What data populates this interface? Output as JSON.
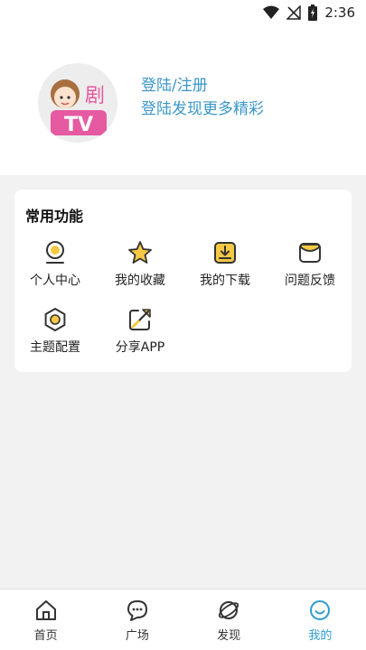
{
  "status_bar": {
    "time": "2:36",
    "icons": [
      "wifi-icon",
      "no-signal-icon",
      "battery-charging-icon"
    ]
  },
  "profile": {
    "avatar_text": "剧",
    "avatar_logo": "TV",
    "login_label": "登陆/注册",
    "login_subtitle": "登陆发现更多精彩"
  },
  "functions": {
    "title": "常用功能",
    "items": [
      {
        "label": "个人中心",
        "icon": "user-center-icon"
      },
      {
        "label": "我的收藏",
        "icon": "star-icon"
      },
      {
        "label": "我的下载",
        "icon": "download-icon"
      },
      {
        "label": "问题反馈",
        "icon": "feedback-mail-icon"
      },
      {
        "label": "主题配置",
        "icon": "theme-settings-icon"
      },
      {
        "label": "分享APP",
        "icon": "share-icon"
      }
    ]
  },
  "bottom_nav": {
    "items": [
      {
        "label": "首页",
        "icon": "home-icon"
      },
      {
        "label": "广场",
        "icon": "chat-bubble-icon"
      },
      {
        "label": "发现",
        "icon": "planet-icon"
      },
      {
        "label": "我的",
        "icon": "smiley-icon"
      }
    ],
    "active_index": 3
  },
  "colors": {
    "accent": "#2f9bd1",
    "login_text": "#3a97c9",
    "icon_yellow": "#f6c944",
    "icon_dark": "#333333",
    "avatar_pink": "#e55aa0"
  }
}
